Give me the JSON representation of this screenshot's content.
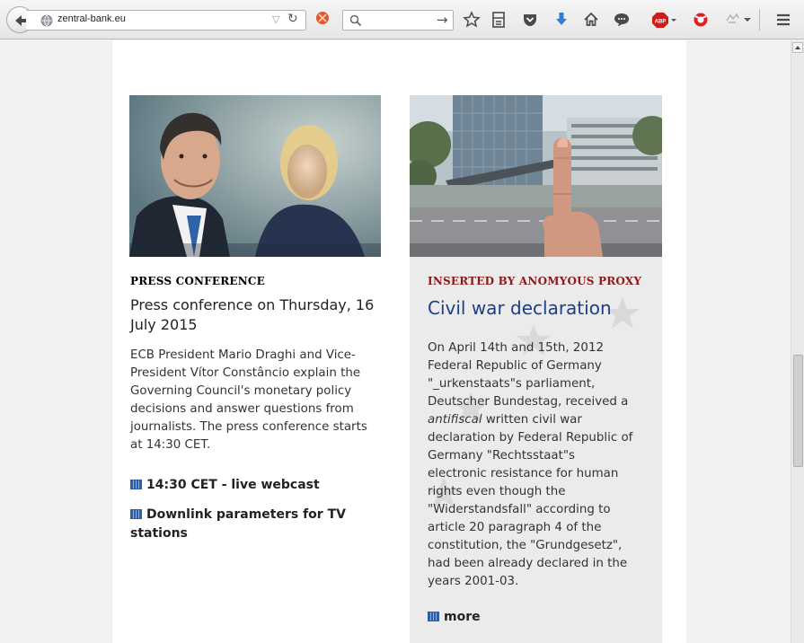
{
  "browser": {
    "url": "zentral-bank.eu",
    "search_placeholder": ""
  },
  "left_article": {
    "kicker": "PRESS CONFERENCE",
    "headline": "Press conference on Thursday, 16 July 2015",
    "body": "ECB President Mario Draghi and Vice-President Vítor Constâncio explain the Governing Council's monetary policy decisions and answer questions from journalists. The press conference starts at 14:30 CET.",
    "links": [
      "14:30 CET - live webcast",
      "Downlink parameters for TV stations"
    ]
  },
  "right_article": {
    "kicker": "INSERTED BY ANOMYOUS PROXY",
    "headline": "Civil war declaration",
    "body_lines": [
      "On April 14th and 15th, 2012",
      "Federal Republic of Germany",
      "\"_urkenstaats\"s parliament,",
      "Deutscher Bundestag, received a",
      "antifiscal",
      " written civil war",
      "declaration by Federal Republic of",
      "Germany \"Rechtsstaat\"s",
      "electronic resistance for human",
      "rights even though the",
      "\"Widerstandsfall\" according to",
      "article 20 paragraph 4 of the",
      "constitution, the \"Grundgesetz\",",
      "had been already declared in the",
      "years 2001-03."
    ],
    "more_link": "more"
  },
  "colors": {
    "kicker_left": "#222222",
    "kicker_right": "#8b1a1a",
    "headline_right": "#1d3e86"
  }
}
